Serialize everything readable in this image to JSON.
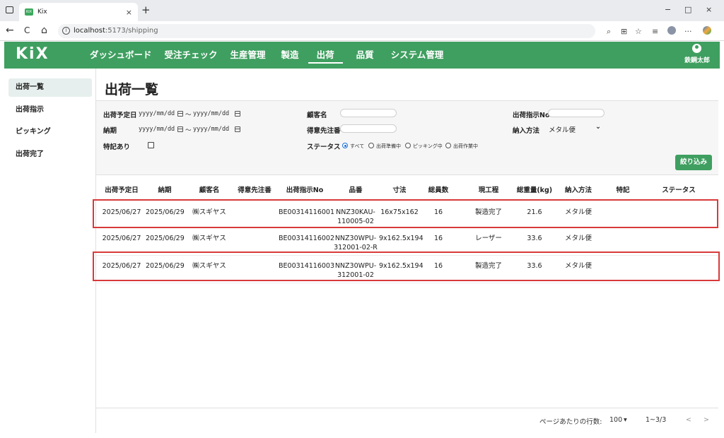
{
  "browser": {
    "tab_title": "Kix",
    "favicon_text": "KiX",
    "url_host": "localhost",
    "url_path": ":5173/shipping",
    "new_tab": "+",
    "tab_close": "×",
    "back": "←",
    "reload": "C",
    "home": "⌂",
    "more": "···",
    "minimize": "−",
    "maximize": "□",
    "close": "×"
  },
  "app": {
    "logo": "KiX",
    "nav": [
      {
        "label": "ダッシュボード"
      },
      {
        "label": "受注チェック"
      },
      {
        "label": "生産管理"
      },
      {
        "label": "製造"
      },
      {
        "label": "出荷",
        "active": true
      },
      {
        "label": "品質"
      },
      {
        "label": "システム管理"
      }
    ],
    "user_name": "鉄鋼太郎"
  },
  "sidebar": {
    "items": [
      {
        "label": "出荷一覧",
        "active": true
      },
      {
        "label": "出荷指示"
      },
      {
        "label": "ピッキング"
      },
      {
        "label": "出荷完了"
      }
    ]
  },
  "page": {
    "title": "出荷一覧"
  },
  "filters": {
    "ship_date_label": "出荷予定日",
    "date_placeholder": "yyyy/mm/dd",
    "range_sep": "～",
    "due_date_label": "納期",
    "remarks_label": "特記あり",
    "customer_label": "顧客名",
    "client_no_label": "得意先注番",
    "status_label": "ステータス",
    "status_options": [
      "すべて",
      "出荷準備中",
      "ピッキング中",
      "出荷作業中"
    ],
    "instruction_no_label": "出荷指示No",
    "delivery_label": "納入方法",
    "delivery_value": "メタル便",
    "delivery_caret": "⌄",
    "filter_button": "絞り込み"
  },
  "table": {
    "headers": [
      "出荷予定日",
      "納期",
      "顧客名",
      "得意先注番",
      "出荷指示No",
      "品番",
      "寸法",
      "総員数",
      "現工程",
      "総重量(kg)",
      "納入方法",
      "特記",
      "ステータス"
    ],
    "rows": [
      {
        "ship_date": "2025/06/27",
        "due": "2025/06/29",
        "customer": "㈱スギヤス",
        "client_no": "",
        "instruction_no": "BE00314116001",
        "part_no_1": "NNZ30KAU-",
        "part_no_2": "110005-02",
        "size": "16x75x162",
        "qty": "16",
        "process": "製造完了",
        "weight": "21.6",
        "delivery": "メタル便",
        "remarks": "",
        "status": ""
      },
      {
        "ship_date": "2025/06/27",
        "due": "2025/06/29",
        "customer": "㈱スギヤス",
        "client_no": "",
        "instruction_no": "BE00314116002",
        "part_no_1": "NNZ30WPU-",
        "part_no_2": "312001-02-R",
        "size": "9x162.5x194",
        "qty": "16",
        "process": "レーザー",
        "weight": "33.6",
        "delivery": "メタル便",
        "remarks": "",
        "status": ""
      },
      {
        "ship_date": "2025/06/27",
        "due": "2025/06/29",
        "customer": "㈱スギヤス",
        "client_no": "",
        "instruction_no": "BE00314116003",
        "part_no_1": "NNZ30WPU-",
        "part_no_2": "312001-02",
        "size": "9x162.5x194",
        "qty": "16",
        "process": "製造完了",
        "weight": "33.6",
        "delivery": "メタル便",
        "remarks": "",
        "status": ""
      }
    ]
  },
  "pagination": {
    "rows_per_page_label": "ページあたりの行数:",
    "rows_per_page": "100",
    "caret": "▾",
    "range": "1~3/3",
    "prev": "<",
    "next": ">"
  }
}
